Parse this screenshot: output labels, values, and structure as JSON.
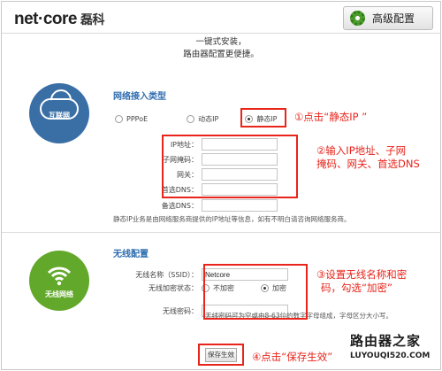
{
  "header": {
    "logo": "net·core",
    "logo_sub": "磊科",
    "advanced_button": "高级配置"
  },
  "tagline": {
    "line1": "一键式安装，",
    "line2": "路由器配置更便捷。"
  },
  "wan": {
    "icon_label": "互联网",
    "title": "网络接入类型",
    "options": [
      "PPPoE",
      "动态IP",
      "静态IP"
    ],
    "selected": "静态IP",
    "fields": [
      {
        "label": "IP地址：",
        "value": ""
      },
      {
        "label": "子网掩码：",
        "value": ""
      },
      {
        "label": "网关：",
        "value": ""
      },
      {
        "label": "首选DNS：",
        "value": ""
      },
      {
        "label": "备选DNS：",
        "value": ""
      }
    ],
    "note": "静态IP业务是由网络服务商提供的IP地址等信息，如有不明白请咨询网络服务商。"
  },
  "wifi": {
    "icon_label": "无线网络",
    "title": "无线配置",
    "ssid_label": "无线名称（SSID）：",
    "ssid_value": "Netcore",
    "enc_label": "无线加密状态：",
    "enc_options": [
      "不加密",
      "加密"
    ],
    "enc_selected": "加密",
    "pwd_label": "无线密码：",
    "pwd_value": "",
    "pwd_hint": "无线密码可为空或由8-63位的数字字母组成，字母区分大小写。"
  },
  "save_button": "保存生效",
  "annotations": {
    "a1": "①点击“静态IP ”",
    "a2_line1": "②输入IP地址、子网",
    "a2_line2": "掩码、网关、首选DNS",
    "a3_line1": "③设置无线名称和密",
    "a3_line2": "码，勾选“加密”",
    "a4": "④点击“保存生效”"
  },
  "watermark": {
    "line1": "路由器之家",
    "line2": "LUYOUQI520.COM"
  },
  "colors": {
    "annotation": "#e8241b",
    "title_blue": "#2f6db0",
    "cloud_circle": "#3a6fa6",
    "wifi_circle": "#62a82a"
  }
}
